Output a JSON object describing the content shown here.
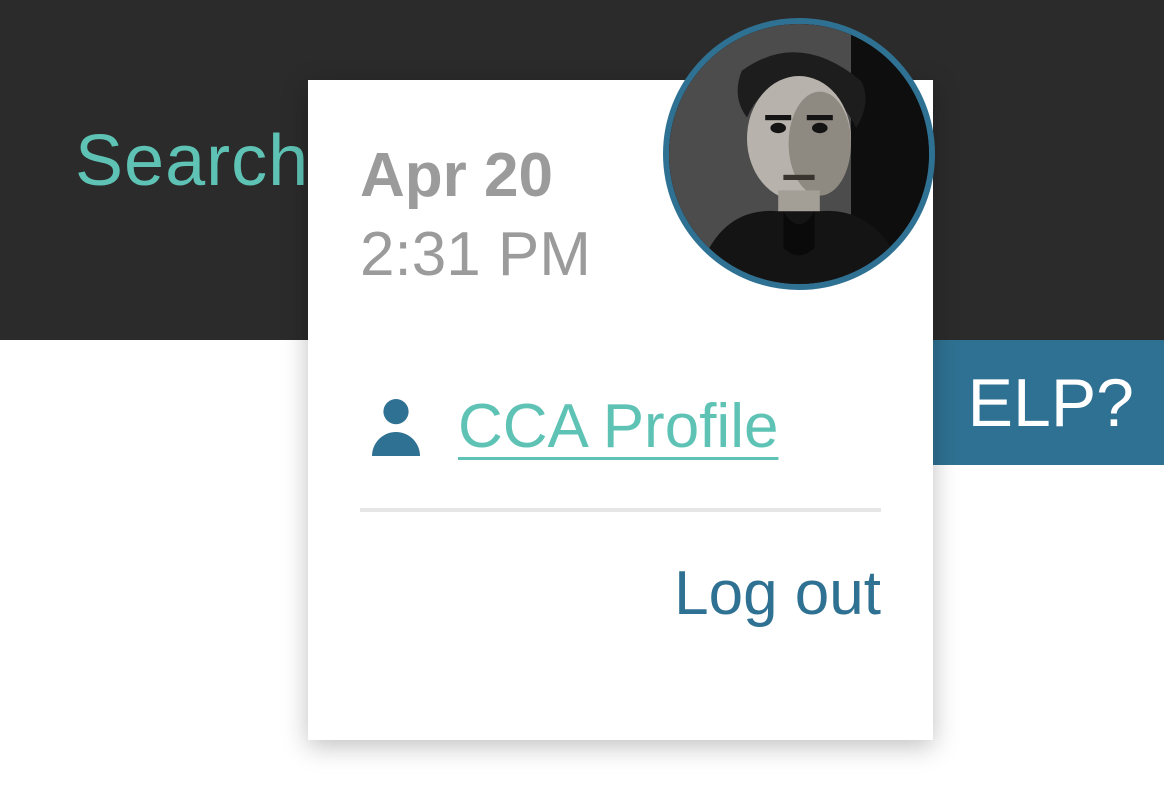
{
  "header": {
    "search_label": "Search"
  },
  "help": {
    "label_visible": "ELP?"
  },
  "dropdown": {
    "date": "Apr 20",
    "time": "2:31 PM",
    "profile_label": "CCA Profile",
    "logout_label": "Log out"
  },
  "icons": {
    "user": "user-icon"
  },
  "colors": {
    "accent_teal": "#5ec3b5",
    "accent_blue": "#2f7192",
    "header_bg": "#2b2b2b",
    "muted_text": "#9b9b9b"
  }
}
